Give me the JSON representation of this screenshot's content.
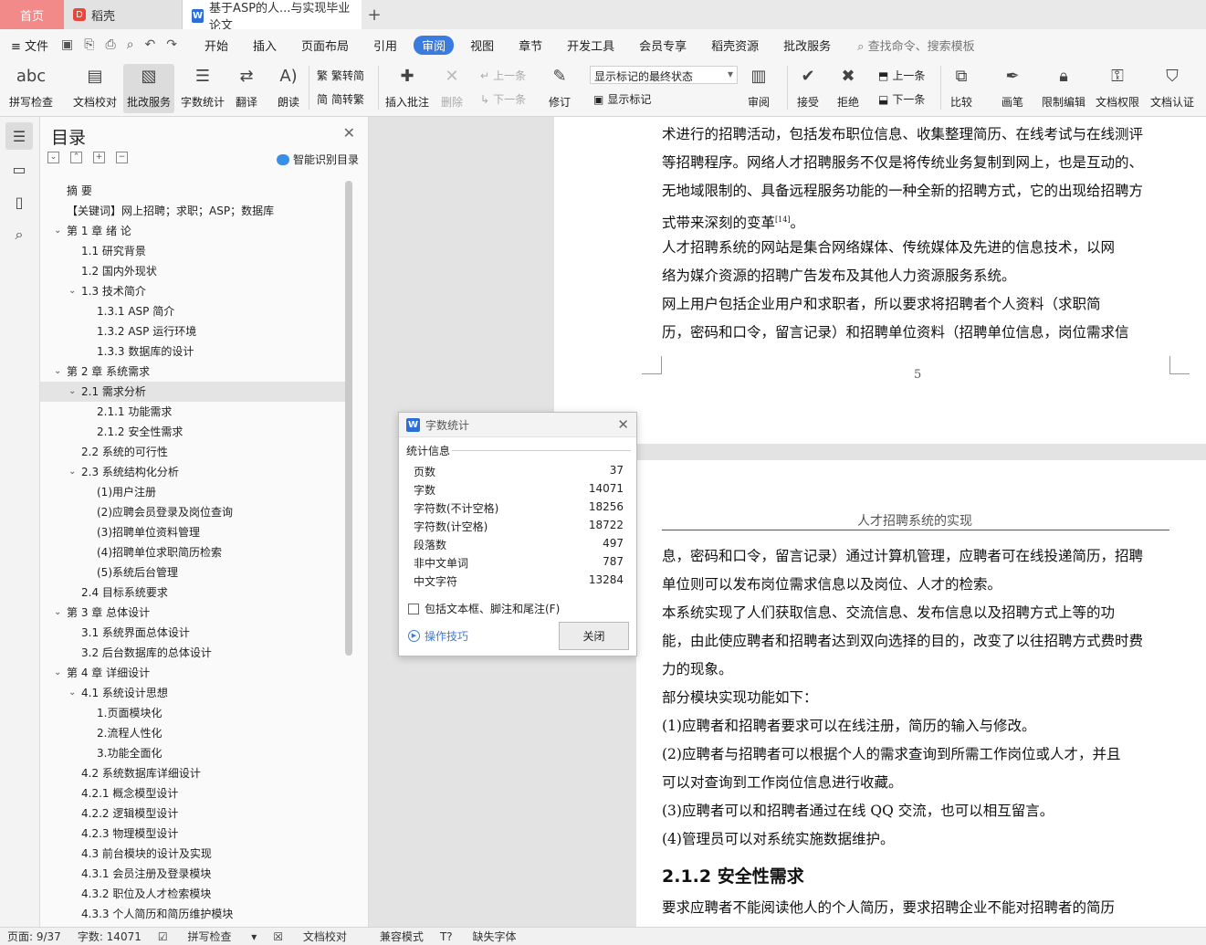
{
  "tabs": {
    "home": "首页",
    "daoke": "稻壳",
    "doc": "基于ASP的人...与实现毕业论文",
    "plus": "+"
  },
  "menu": {
    "file": "文件",
    "items": [
      "开始",
      "插入",
      "页面布局",
      "引用",
      "审阅",
      "视图",
      "章节",
      "开发工具",
      "会员专享",
      "稻壳资源",
      "批改服务"
    ],
    "active_index": 4,
    "search": "查找命令、搜索模板"
  },
  "ribbon": {
    "spell": "拼写检查",
    "proof": "文档校对",
    "review_service": "批改服务",
    "word_count": "字数统计",
    "translate": "翻译",
    "read_aloud": "朗读",
    "trad": "繁转简",
    "simp": "简转繁",
    "insert_comment": "插入批注",
    "delete": "删除",
    "prev": "上一条",
    "next": "下一条",
    "revise": "修订",
    "markup_state": "显示标记的最终状态",
    "show_markup": "显示标记",
    "review": "审阅",
    "accept": "接受",
    "reject": "拒绝",
    "prev2": "上一条",
    "next2": "下一条",
    "compare": "比较",
    "pen": "画笔",
    "restrict": "限制编辑",
    "rights": "文档权限",
    "certify": "文档认证"
  },
  "toc": {
    "title": "目录",
    "smart": "智能识别目录",
    "items": [
      {
        "text": "摘  要",
        "level": 0,
        "caret": ""
      },
      {
        "text": "【关键词】网上招聘；求职；ASP；数据库",
        "level": 0,
        "caret": ""
      },
      {
        "text": "第 1 章 绪 论",
        "level": 0,
        "caret": "v"
      },
      {
        "text": "1.1 研究背景",
        "level": 1,
        "caret": ""
      },
      {
        "text": "1.2 国内外现状",
        "level": 1,
        "caret": ""
      },
      {
        "text": "1.3 技术简介",
        "level": 1,
        "caret": "v"
      },
      {
        "text": "1.3.1 ASP 简介",
        "level": 2,
        "caret": ""
      },
      {
        "text": "1.3.2 ASP 运行环境",
        "level": 2,
        "caret": ""
      },
      {
        "text": "1.3.3 数据库的设计",
        "level": 2,
        "caret": ""
      },
      {
        "text": "第 2 章  系统需求",
        "level": 0,
        "caret": "v"
      },
      {
        "text": "2.1 需求分析",
        "level": 1,
        "caret": "v",
        "active": true
      },
      {
        "text": "2.1.1 功能需求",
        "level": 2,
        "caret": ""
      },
      {
        "text": "2.1.2 安全性需求",
        "level": 2,
        "caret": ""
      },
      {
        "text": "2.2  系统的可行性",
        "level": 1,
        "caret": ""
      },
      {
        "text": "2.3  系统结构化分析",
        "level": 1,
        "caret": "v"
      },
      {
        "text": "(1)用户注册",
        "level": 2,
        "caret": ""
      },
      {
        "text": "(2)应聘会员登录及岗位查询",
        "level": 2,
        "caret": ""
      },
      {
        "text": "(3)招聘单位资料管理",
        "level": 2,
        "caret": ""
      },
      {
        "text": "(4)招聘单位求职简历检索",
        "level": 2,
        "caret": ""
      },
      {
        "text": "(5)系统后台管理",
        "level": 2,
        "caret": ""
      },
      {
        "text": "2.4 目标系统要求",
        "level": 1,
        "caret": ""
      },
      {
        "text": "第 3 章  总体设计",
        "level": 0,
        "caret": "v"
      },
      {
        "text": "3.1 系统界面总体设计",
        "level": 1,
        "caret": ""
      },
      {
        "text": "3.2  后台数据库的总体设计",
        "level": 1,
        "caret": ""
      },
      {
        "text": "第 4 章  详细设计",
        "level": 0,
        "caret": "v"
      },
      {
        "text": "4.1 系统设计思想",
        "level": 1,
        "caret": "v"
      },
      {
        "text": "1.页面模块化",
        "level": 2,
        "caret": ""
      },
      {
        "text": "2.流程人性化",
        "level": 2,
        "caret": ""
      },
      {
        "text": "3.功能全面化",
        "level": 2,
        "caret": ""
      },
      {
        "text": "4.2 系统数据库详细设计",
        "level": 1,
        "caret": ""
      },
      {
        "text": "4.2.1 概念模型设计",
        "level": 1,
        "caret": ""
      },
      {
        "text": "4.2.2 逻辑模型设计",
        "level": 1,
        "caret": ""
      },
      {
        "text": "4.2.3 物理模型设计",
        "level": 1,
        "caret": ""
      },
      {
        "text": "4.3 前台模块的设计及实现",
        "level": 1,
        "caret": ""
      },
      {
        "text": "4.3.1 会员注册及登录模块",
        "level": 1,
        "caret": ""
      },
      {
        "text": "4.3.2 职位及人才检索模块",
        "level": 1,
        "caret": ""
      },
      {
        "text": "4.3.3 个人简历和简历维护模块",
        "level": 1,
        "caret": ""
      }
    ]
  },
  "page1": {
    "lines": [
      "术进行的招聘活动，包括发布职位信息、收集整理简历、在线考试与在线测评",
      "等招聘程序。网络人才招聘服务不仅是将传统业务复制到网上，也是互动的、",
      "无地域限制的、具备远程服务功能的一种全新的招聘方式，它的出现给招聘方",
      "式带来深刻的变革",
      "    人才招聘系统的网站是集合网络媒体、传统媒体及先进的信息技术，以网",
      "络为媒介资源的招聘广告发布及其他人力资源服务系统。",
      "    网上用户包括企业用户和求职者，所以要求将招聘者个人资料（求职简",
      "历，密码和口令，留言记录）和招聘单位资料（招聘单位信息，岗位需求信"
    ],
    "cite": "[14]",
    "tail": "。",
    "page_number": "5"
  },
  "page2": {
    "header": "人才招聘系统的实现",
    "lines": [
      "息，密码和口令，留言记录）通过计算机管理，应聘者可在线投递简历，招聘",
      "单位则可以发布岗位需求信息以及岗位、人才的检索。",
      "    本系统实现了人们获取信息、交流信息、发布信息以及招聘方式上等的功",
      "能，由此使应聘者和招聘者达到双向选择的目的，改变了以往招聘方式费时费",
      "力的现象。",
      "    部分模块实现功能如下：",
      "    (1)应聘者和招聘者要求可以在线注册，简历的输入与修改。",
      "    (2)应聘者与招聘者可以根据个人的需求查询到所需工作岗位或人才，并且",
      "        可以对查询到工作岗位信息进行收藏。",
      "    (3)应聘者可以和招聘者通过在线 QQ 交流，也可以相互留言。",
      "    (4)管理员可以对系统实施数据维护。"
    ],
    "heading": "2.1.2 安全性需求",
    "last_line": "    要求应聘者不能阅读他人的个人简历，要求招聘企业不能对招聘者的简历"
  },
  "dialog": {
    "title": "字数统计",
    "section": "统计信息",
    "rows": [
      {
        "label": "页数",
        "value": "37"
      },
      {
        "label": "字数",
        "value": "14071"
      },
      {
        "label": "字符数(不计空格)",
        "value": "18256"
      },
      {
        "label": "字符数(计空格)",
        "value": "18722"
      },
      {
        "label": "段落数",
        "value": "497"
      },
      {
        "label": "非中文单词",
        "value": "787"
      },
      {
        "label": "中文字符",
        "value": "13284"
      }
    ],
    "checkbox": "包括文本框、脚注和尾注(F)",
    "tips": "操作技巧",
    "close": "关闭"
  },
  "status": {
    "page": "页面: 9/37",
    "words": "字数: 14071",
    "spell": "拼写检查",
    "proof": "文档校对",
    "compat": "兼容模式",
    "font": "缺失字体"
  },
  "colors": {
    "accent": "#3a7be0",
    "home_tab": "#f28a8a"
  }
}
